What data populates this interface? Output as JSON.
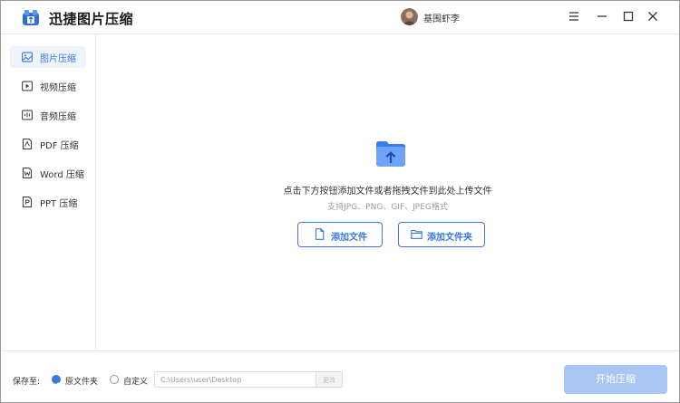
{
  "app": {
    "title": "迅捷图片压缩"
  },
  "user": {
    "name": "基围虾李"
  },
  "sidebar": {
    "items": [
      {
        "label": "图片压缩",
        "icon": "image-icon",
        "active": true
      },
      {
        "label": "视频压缩",
        "icon": "video-icon",
        "active": false
      },
      {
        "label": "音频压缩",
        "icon": "audio-icon",
        "active": false
      },
      {
        "label": "PDF 压缩",
        "icon": "pdf-icon",
        "active": false
      },
      {
        "label": "Word 压缩",
        "icon": "word-icon",
        "active": false
      },
      {
        "label": "PPT 压缩",
        "icon": "ppt-icon",
        "active": false
      }
    ]
  },
  "main": {
    "hint": "点击下方按钮添加文件或者拖拽文件到此处上传文件",
    "supported": "支持JPG、PNG、GIF、JPEG格式",
    "add_file": "添加文件",
    "add_folder": "添加文件夹"
  },
  "footer": {
    "save_to": "保存至:",
    "option_original": "原文件夹",
    "option_custom": "自定义",
    "path": "C:\\Users\\user\\Desktop",
    "change": "更改",
    "start": "开始压缩"
  },
  "colors": {
    "accent": "#3b76e1",
    "start_disabled": "#a9c5f3"
  }
}
